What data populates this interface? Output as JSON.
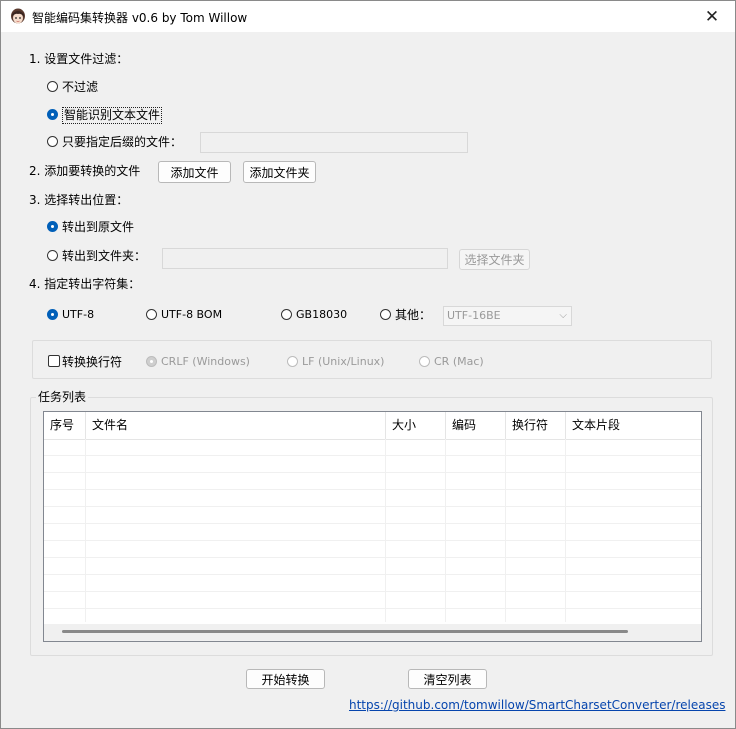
{
  "window": {
    "title": "智能编码集转换器 v0.6 by Tom Willow",
    "close_glyph": "✕"
  },
  "filter": {
    "heading": "1. 设置文件过滤：",
    "options": [
      "不过滤",
      "智能识别文本文件",
      "只要指定后缀的文件："
    ],
    "selected_index": 1,
    "suffix_value": ""
  },
  "add": {
    "heading": "2. 添加要转换的文件",
    "add_files_label": "添加文件",
    "add_folder_label": "添加文件夹"
  },
  "output": {
    "heading": "3. 选择转出位置：",
    "options": [
      "转出到原文件",
      "转出到文件夹："
    ],
    "selected_index": 0,
    "folder_value": "",
    "choose_folder_label": "选择文件夹"
  },
  "charset": {
    "heading": "4. 指定转出字符集：",
    "options": [
      "UTF-8",
      "UTF-8 BOM",
      "GB18030",
      "其他："
    ],
    "selected_index": 0,
    "other_value": "UTF-16BE"
  },
  "newline": {
    "convert_label": "转换换行符",
    "convert_checked": false,
    "options": [
      "CRLF (Windows)",
      "LF (Unix/Linux)",
      "CR (Mac)"
    ],
    "selected_index": 0
  },
  "tasks": {
    "group_label": "任务列表",
    "columns": [
      "序号",
      "文件名",
      "大小",
      "编码",
      "换行符",
      "文本片段"
    ],
    "rows": []
  },
  "actions": {
    "start_label": "开始转换",
    "clear_label": "清空列表",
    "link_text": "https://github.com/tomwillow/SmartCharsetConverter/releases"
  },
  "colors": {
    "accent": "#005fb8",
    "link": "#0645ad"
  }
}
